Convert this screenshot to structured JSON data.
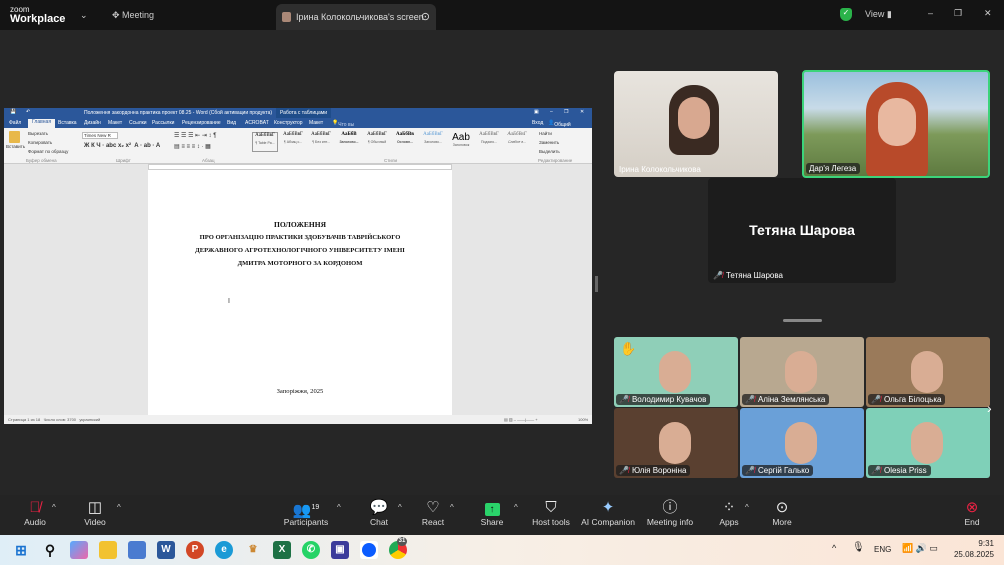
{
  "topbar": {
    "brand_small": "zoom",
    "brand": "Workplace",
    "meeting": "Meeting",
    "share_title": "Ірина Колокольчикова's screen",
    "view": "View"
  },
  "word": {
    "title": "Положення закордонна практика проект 08.25 - Word (Сбой активации продукта)",
    "table_tools": "Работа с таблицами",
    "tell_me": "Что вы хотите сделать?",
    "share": "Общий доступ",
    "sign_in": "Вход",
    "tabs": [
      "Файл",
      "Главная",
      "Вставка",
      "Дизайн",
      "Макет",
      "Ссылки",
      "Рассылки",
      "Рецензирование",
      "Вид",
      "ACROBAT",
      "Конструктор",
      "Макет"
    ],
    "clipboard": {
      "paste": "Вставить",
      "cut": "Вырезать",
      "copy": "Копировать",
      "format": "Формат по образцу",
      "group": "Буфер обмена"
    },
    "font": {
      "name": "Times New R",
      "group": "Шрифт"
    },
    "para_group": "Абзац",
    "styles_group": "Стили",
    "edit_group": "Редактирование",
    "styles": [
      {
        "s": "AaБбВвГ",
        "l": "¶ Table Pa..."
      },
      {
        "s": "AaБбВвГ",
        "l": "¶ Абзац с..."
      },
      {
        "s": "AaБбВвГ",
        "l": "¶ Без инт..."
      },
      {
        "s": "AaБбВ",
        "l": "Заголово..."
      },
      {
        "s": "AaБбВвГ",
        "l": "¶ Обычный"
      },
      {
        "s": "AaБбВв",
        "l": "Основн..."
      },
      {
        "s": "AaБбВвГ",
        "l": "Заголово..."
      },
      {
        "s": "Aab",
        "l": "Заголовок"
      },
      {
        "s": "AaБбВвГ",
        "l": "Подзаго..."
      },
      {
        "s": "AaБбВвГ",
        "l": "Слабое в..."
      }
    ],
    "editing": [
      "Найти",
      "Заменить",
      "Выделить"
    ],
    "doc": {
      "title": "ПОЛОЖЕННЯ",
      "lines": [
        "ПРО ОРГАНІЗАЦІЮ ПРАКТИКИ ЗДОБУВАЧІВ ТАВРІЙСЬКОГО",
        "ДЕРЖАВНОГО АГРОТЕХНОЛОГІЧНОГО УНІВЕРСИТЕТУ ІМЕНІ",
        "ДМИТРА МОТОРНОГО ЗА КОРДОНОМ"
      ],
      "footer": "Запоріжжя, 2025"
    },
    "status": {
      "page": "Страница 1 из 18",
      "words": "Число слов: 3700",
      "lang": "украинский",
      "zoom": "100%"
    }
  },
  "participants": {
    "top": [
      {
        "name": "Ірина Колокольчикова"
      },
      {
        "name": "Дар'я Легеза"
      }
    ],
    "no_video": {
      "name": "Тетяна Шарова",
      "big_name": "Тетяна Шарова"
    },
    "grid": [
      {
        "name": "Володимир Кувачов",
        "bg": "#8fcfb8"
      },
      {
        "name": "Аліна Землянська",
        "bg": "#b8a890"
      },
      {
        "name": "Ольга Білоцька",
        "bg": "#9a7a5a"
      },
      {
        "name": "Юлія Вороніна",
        "bg": "#5a4030"
      },
      {
        "name": "Сергій Галько",
        "bg": "#6aa0d8"
      },
      {
        "name": "Olesia Priss",
        "bg": "#7fd0b8"
      }
    ]
  },
  "toolbar": {
    "audio": "Audio",
    "video": "Video",
    "participants": "Participants",
    "participants_count": "19",
    "chat": "Chat",
    "react": "React",
    "share": "Share",
    "host_tools": "Host tools",
    "ai": "AI Companion",
    "info": "Meeting info",
    "apps": "Apps",
    "more": "More",
    "end": "End"
  },
  "taskbar": {
    "lang": "ENG",
    "time": "9:31",
    "date": "25.08.2025",
    "chrome_badge": "31"
  }
}
